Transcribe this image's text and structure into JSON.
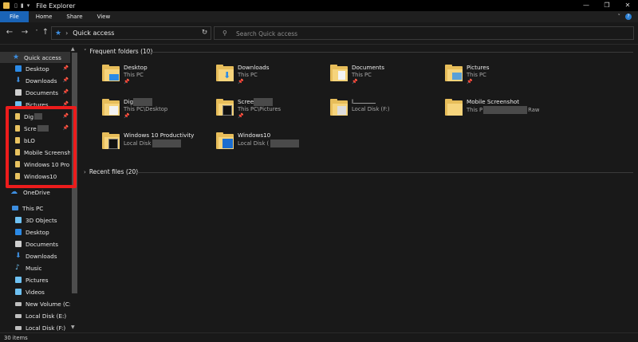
{
  "window": {
    "title": "File Explorer"
  },
  "ribbon": {
    "tabs": [
      "File",
      "Home",
      "Share",
      "View"
    ]
  },
  "address": {
    "location": "Quick access"
  },
  "search": {
    "placeholder": "Search Quick access"
  },
  "sidebar": {
    "items": [
      {
        "label": "Quick access",
        "icon": "star-icon",
        "pinned": false
      },
      {
        "label": "Desktop",
        "icon": "desktop-icon",
        "pinned": true
      },
      {
        "label": "Downloads",
        "icon": "download-arrow-icon",
        "pinned": true
      },
      {
        "label": "Documents",
        "icon": "document-icon",
        "pinned": true
      },
      {
        "label": "Pictures",
        "icon": "pictures-icon",
        "pinned": true
      },
      {
        "label": "Dig",
        "icon": "folder-icon",
        "pinned": true
      },
      {
        "label": "Scre",
        "icon": "folder-icon",
        "pinned": true
      },
      {
        "label": "bLO",
        "icon": "folder-icon",
        "pinned": false
      },
      {
        "label": "Mobile Screensh",
        "icon": "folder-icon",
        "pinned": false
      },
      {
        "label": "Windows 10 Pro",
        "icon": "folder-icon",
        "pinned": false
      },
      {
        "label": "Windows10",
        "icon": "folder-icon",
        "pinned": false
      },
      {
        "label": "OneDrive",
        "icon": "cloud-icon",
        "pinned": false
      },
      {
        "label": "This PC",
        "icon": "computer-icon",
        "pinned": false
      },
      {
        "label": "3D Objects",
        "icon": "cube-icon",
        "pinned": false
      },
      {
        "label": "Desktop",
        "icon": "desktop-icon",
        "pinned": false
      },
      {
        "label": "Documents",
        "icon": "document-icon",
        "pinned": false
      },
      {
        "label": "Downloads",
        "icon": "download-arrow-icon",
        "pinned": false
      },
      {
        "label": "Music",
        "icon": "music-note-icon",
        "pinned": false
      },
      {
        "label": "Pictures",
        "icon": "pictures-icon",
        "pinned": false
      },
      {
        "label": "Videos",
        "icon": "video-icon",
        "pinned": false
      },
      {
        "label": "New Volume (C:)",
        "icon": "drive-icon",
        "pinned": false
      },
      {
        "label": "Local Disk (E:)",
        "icon": "drive-icon",
        "pinned": false
      },
      {
        "label": "Local Disk (F:)",
        "icon": "drive-icon",
        "pinned": false
      }
    ]
  },
  "main": {
    "frequent_header": "Frequent folders (10)",
    "recent_header": "Recent files (20)",
    "folders": [
      {
        "name": "Desktop",
        "location": "This PC",
        "icon": "desktop-folder-icon"
      },
      {
        "name": "Downloads",
        "location": "This PC",
        "icon": "downloads-folder-icon"
      },
      {
        "name": "Documents",
        "location": "This PC",
        "icon": "documents-folder-icon"
      },
      {
        "name": "Pictures",
        "location": "This PC",
        "icon": "pictures-folder-icon"
      },
      {
        "name": "Dig",
        "location": "This PC\\Desktop",
        "icon": "folder-icon"
      },
      {
        "name": "Scree",
        "location": "This PC\\Pictures",
        "icon": "folder-icon"
      },
      {
        "name": "l",
        "location": "Local Disk (F:)",
        "icon": "folder-icon"
      },
      {
        "name": "Mobile Screenshot",
        "location": "This P",
        "location_suffix": "Raw",
        "icon": "folder-icon"
      },
      {
        "name": "Windows 10 Productivity",
        "location": "Local Disk",
        "icon": "folder-icon"
      },
      {
        "name": "Windows10",
        "location": "Local Disk (",
        "icon": "folder-icon"
      }
    ]
  },
  "status": {
    "item_count": "30 items"
  }
}
